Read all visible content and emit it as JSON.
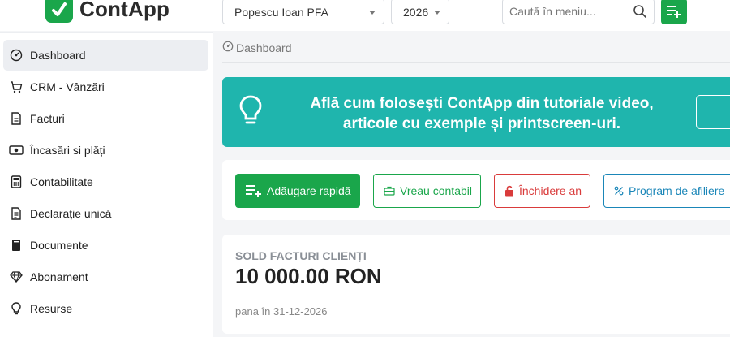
{
  "app": {
    "logo_text": "ContApp"
  },
  "header": {
    "company_selected": "Popescu Ioan PFA",
    "year_selected": "2026",
    "search_placeholder": "Caută în meniu..."
  },
  "sidebar": {
    "items": [
      {
        "label": "Dashboard",
        "icon": "dashboard-icon",
        "active": true
      },
      {
        "label": "CRM - Vânzări",
        "icon": "cart-icon"
      },
      {
        "label": "Facturi",
        "icon": "invoice-icon"
      },
      {
        "label": "Încasări si plăți",
        "icon": "cash-icon"
      },
      {
        "label": "Contabilitate",
        "icon": "calculator-icon"
      },
      {
        "label": "Declarație unică",
        "icon": "declaration-icon"
      },
      {
        "label": "Documente",
        "icon": "documents-icon"
      },
      {
        "label": "Abonament",
        "icon": "diamond-icon"
      },
      {
        "label": "Resurse",
        "icon": "lightbulb-icon"
      }
    ]
  },
  "breadcrumb": {
    "label": "Dashboard"
  },
  "banner": {
    "line1": "Află cum folosești ContApp din tutoriale video,",
    "line2": "articole cu exemple și printscreen-uri."
  },
  "actions": {
    "quick_add": "Adăugare rapidă",
    "want_accountant": "Vreau contabil",
    "close_year": "Închidere an",
    "affiliate": "Program de afiliere"
  },
  "balance_card": {
    "title": "SOLD FACTURI CLIENȚI",
    "value": "10 000.00 RON",
    "date_note": "pana în 31-12-2026"
  },
  "colors": {
    "brand": "#1aa64b",
    "banner": "#1fb5ad",
    "danger": "#d93b3b",
    "info": "#1a86b8"
  }
}
